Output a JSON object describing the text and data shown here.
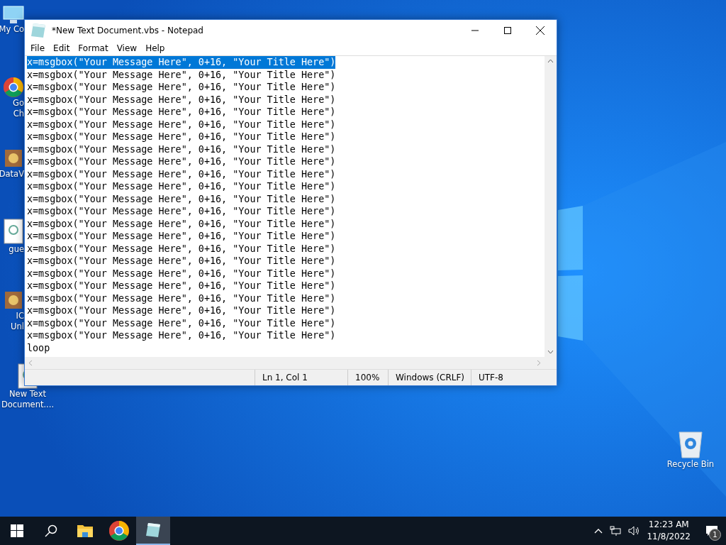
{
  "desktop_icons": [
    {
      "kind": "partial",
      "lines": [
        "My Co"
      ]
    },
    {
      "kind": "partial",
      "lines": [
        "Go",
        "Ch"
      ]
    },
    {
      "kind": "partial",
      "lines": [
        "DataV"
      ]
    },
    {
      "kind": "partial",
      "lines": [
        "gue"
      ]
    },
    {
      "kind": "partial",
      "lines": [
        "IC",
        "Unl"
      ]
    },
    {
      "kind": "full",
      "lines": [
        "New Text",
        "Document...."
      ]
    },
    {
      "kind": "right",
      "lines": [
        "Recycle Bin"
      ]
    }
  ],
  "window": {
    "title": "*New Text Document.vbs - Notepad",
    "menu": [
      "File",
      "Edit",
      "Format",
      "View",
      "Help"
    ],
    "lines": [
      {
        "text": "x=msgbox(\"Your Message Here\", 0+16, \"Your Title Here\")",
        "selected": true
      },
      {
        "text": "x=msgbox(\"Your Message Here\", 0+16, \"Your Title Here\")",
        "selected": false
      },
      {
        "text": "x=msgbox(\"Your Message Here\", 0+16, \"Your Title Here\")",
        "selected": false
      },
      {
        "text": "x=msgbox(\"Your Message Here\", 0+16, \"Your Title Here\")",
        "selected": false
      },
      {
        "text": "x=msgbox(\"Your Message Here\", 0+16, \"Your Title Here\")",
        "selected": false
      },
      {
        "text": "x=msgbox(\"Your Message Here\", 0+16, \"Your Title Here\")",
        "selected": false
      },
      {
        "text": "x=msgbox(\"Your Message Here\", 0+16, \"Your Title Here\")",
        "selected": false
      },
      {
        "text": "x=msgbox(\"Your Message Here\", 0+16, \"Your Title Here\")",
        "selected": false
      },
      {
        "text": "x=msgbox(\"Your Message Here\", 0+16, \"Your Title Here\")",
        "selected": false
      },
      {
        "text": "x=msgbox(\"Your Message Here\", 0+16, \"Your Title Here\")",
        "selected": false
      },
      {
        "text": "x=msgbox(\"Your Message Here\", 0+16, \"Your Title Here\")",
        "selected": false
      },
      {
        "text": "x=msgbox(\"Your Message Here\", 0+16, \"Your Title Here\")",
        "selected": false
      },
      {
        "text": "x=msgbox(\"Your Message Here\", 0+16, \"Your Title Here\")",
        "selected": false
      },
      {
        "text": "x=msgbox(\"Your Message Here\", 0+16, \"Your Title Here\")",
        "selected": false
      },
      {
        "text": "x=msgbox(\"Your Message Here\", 0+16, \"Your Title Here\")",
        "selected": false
      },
      {
        "text": "x=msgbox(\"Your Message Here\", 0+16, \"Your Title Here\")",
        "selected": false
      },
      {
        "text": "x=msgbox(\"Your Message Here\", 0+16, \"Your Title Here\")",
        "selected": false
      },
      {
        "text": "x=msgbox(\"Your Message Here\", 0+16, \"Your Title Here\")",
        "selected": false
      },
      {
        "text": "x=msgbox(\"Your Message Here\", 0+16, \"Your Title Here\")",
        "selected": false
      },
      {
        "text": "x=msgbox(\"Your Message Here\", 0+16, \"Your Title Here\")",
        "selected": false
      },
      {
        "text": "x=msgbox(\"Your Message Here\", 0+16, \"Your Title Here\")",
        "selected": false
      },
      {
        "text": "x=msgbox(\"Your Message Here\", 0+16, \"Your Title Here\")",
        "selected": false
      },
      {
        "text": "x=msgbox(\"Your Message Here\", 0+16, \"Your Title Here\")",
        "selected": false
      },
      {
        "text": "loop",
        "selected": false
      }
    ],
    "status": [
      "Ln 1, Col 1",
      "100%",
      "Windows (CRLF)",
      "UTF-8"
    ]
  },
  "taskbar": {
    "apps": [
      {
        "selected": false
      },
      {
        "selected": false
      },
      {
        "selected": true
      }
    ],
    "time": "12:23 AM",
    "date": "11/8/2022",
    "notifications": "1"
  }
}
